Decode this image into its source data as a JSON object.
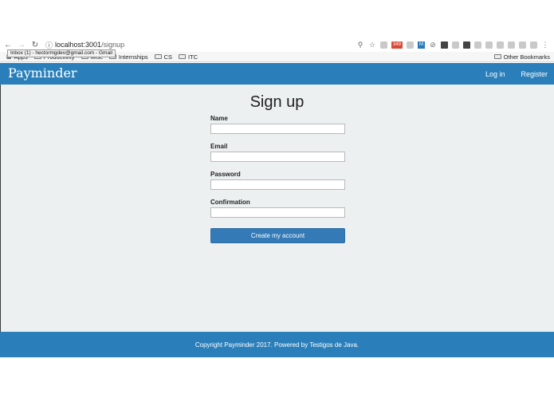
{
  "browser": {
    "url_host": "localhost:3001",
    "url_path": "/signup",
    "tooltip": "Inbox (1) - hectormgdev@gmail.com - Gmail",
    "ext_badge": "349",
    "ext_m": "M",
    "bookmarks": [
      "Apps",
      "Productivity",
      "Misc",
      "Internships",
      "CS",
      "ITC"
    ],
    "other_bookmarks": "Other Bookmarks"
  },
  "navbar": {
    "brand": "Payminder",
    "login": "Log in",
    "register": "Register",
    "color": "#2a7fba"
  },
  "form": {
    "title": "Sign up",
    "name_label": "Name",
    "email_label": "Email",
    "password_label": "Password",
    "confirmation_label": "Confirmation",
    "name_value": "",
    "email_value": "",
    "password_value": "",
    "confirmation_value": "",
    "submit": "Create my account"
  },
  "footer": {
    "text": "Copyright Payminder 2017. Powered by Testigos de Java."
  }
}
